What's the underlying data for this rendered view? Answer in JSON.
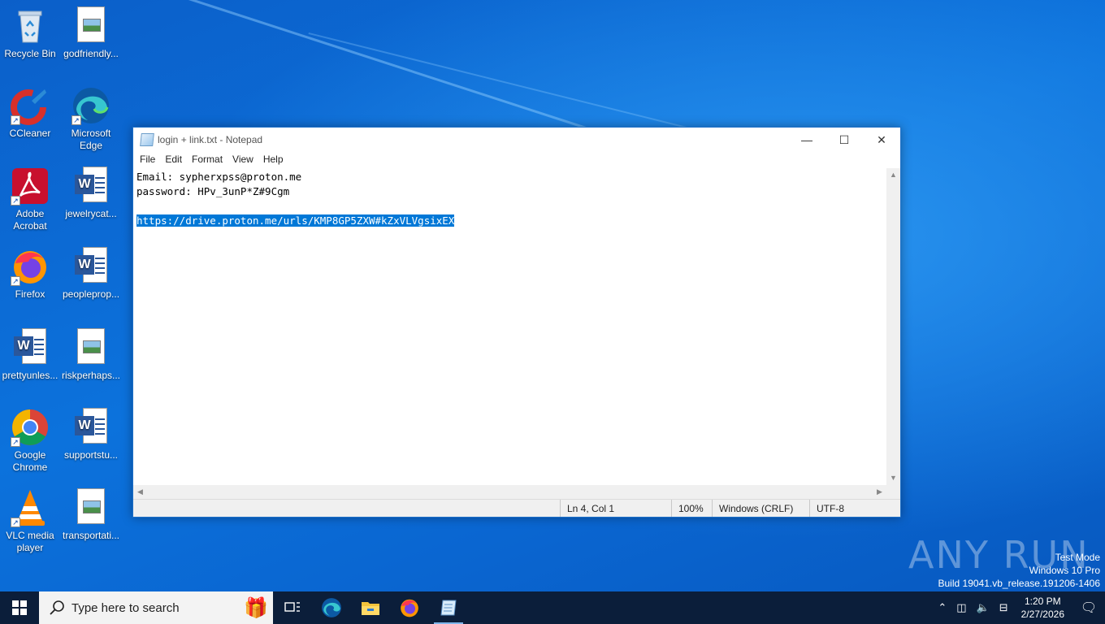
{
  "desktop": {
    "icons": [
      {
        "label": "Recycle Bin",
        "icon": "recycle-bin-icon"
      },
      {
        "label": "godfriendly...",
        "icon": "image-file-icon"
      },
      {
        "label": "CCleaner",
        "icon": "ccleaner-icon"
      },
      {
        "label": "Microsoft Edge",
        "icon": "edge-icon"
      },
      {
        "label": "Adobe Acrobat",
        "icon": "acrobat-icon"
      },
      {
        "label": "jewelrycat...",
        "icon": "word-doc-icon"
      },
      {
        "label": "Firefox",
        "icon": "firefox-icon"
      },
      {
        "label": "peopleprop...",
        "icon": "word-doc-icon"
      },
      {
        "label": "prettyunles...",
        "icon": "word-doc-icon"
      },
      {
        "label": "riskperhaps...",
        "icon": "image-file-icon"
      },
      {
        "label": "Google Chrome",
        "icon": "chrome-icon"
      },
      {
        "label": "supportstu...",
        "icon": "word-doc-icon"
      },
      {
        "label": "VLC media player",
        "icon": "vlc-icon"
      },
      {
        "label": "transportati...",
        "icon": "image-file-icon"
      }
    ]
  },
  "notepad": {
    "title": "login + link.txt - Notepad",
    "menu": [
      "File",
      "Edit",
      "Format",
      "View",
      "Help"
    ],
    "lines": [
      "Email: sypherxpss@proton.me",
      "password: HPv_3unP*Z#9Cgm",
      "",
      "https://drive.proton.me/urls/KMP8GP5ZXW#kZxVLVgsixEX"
    ],
    "status": {
      "position": "Ln 4, Col 1",
      "zoom": "100%",
      "line_ending": "Windows (CRLF)",
      "encoding": "UTF-8"
    }
  },
  "watermark": {
    "brand": "ANY RUN",
    "line1": "Test Mode",
    "line2": "Windows 10 Pro",
    "line3": "Build 19041.vb_release.191206-1406"
  },
  "taskbar": {
    "search_placeholder": "Type here to search",
    "time": "1:20 PM",
    "date": "2/27/2026"
  }
}
